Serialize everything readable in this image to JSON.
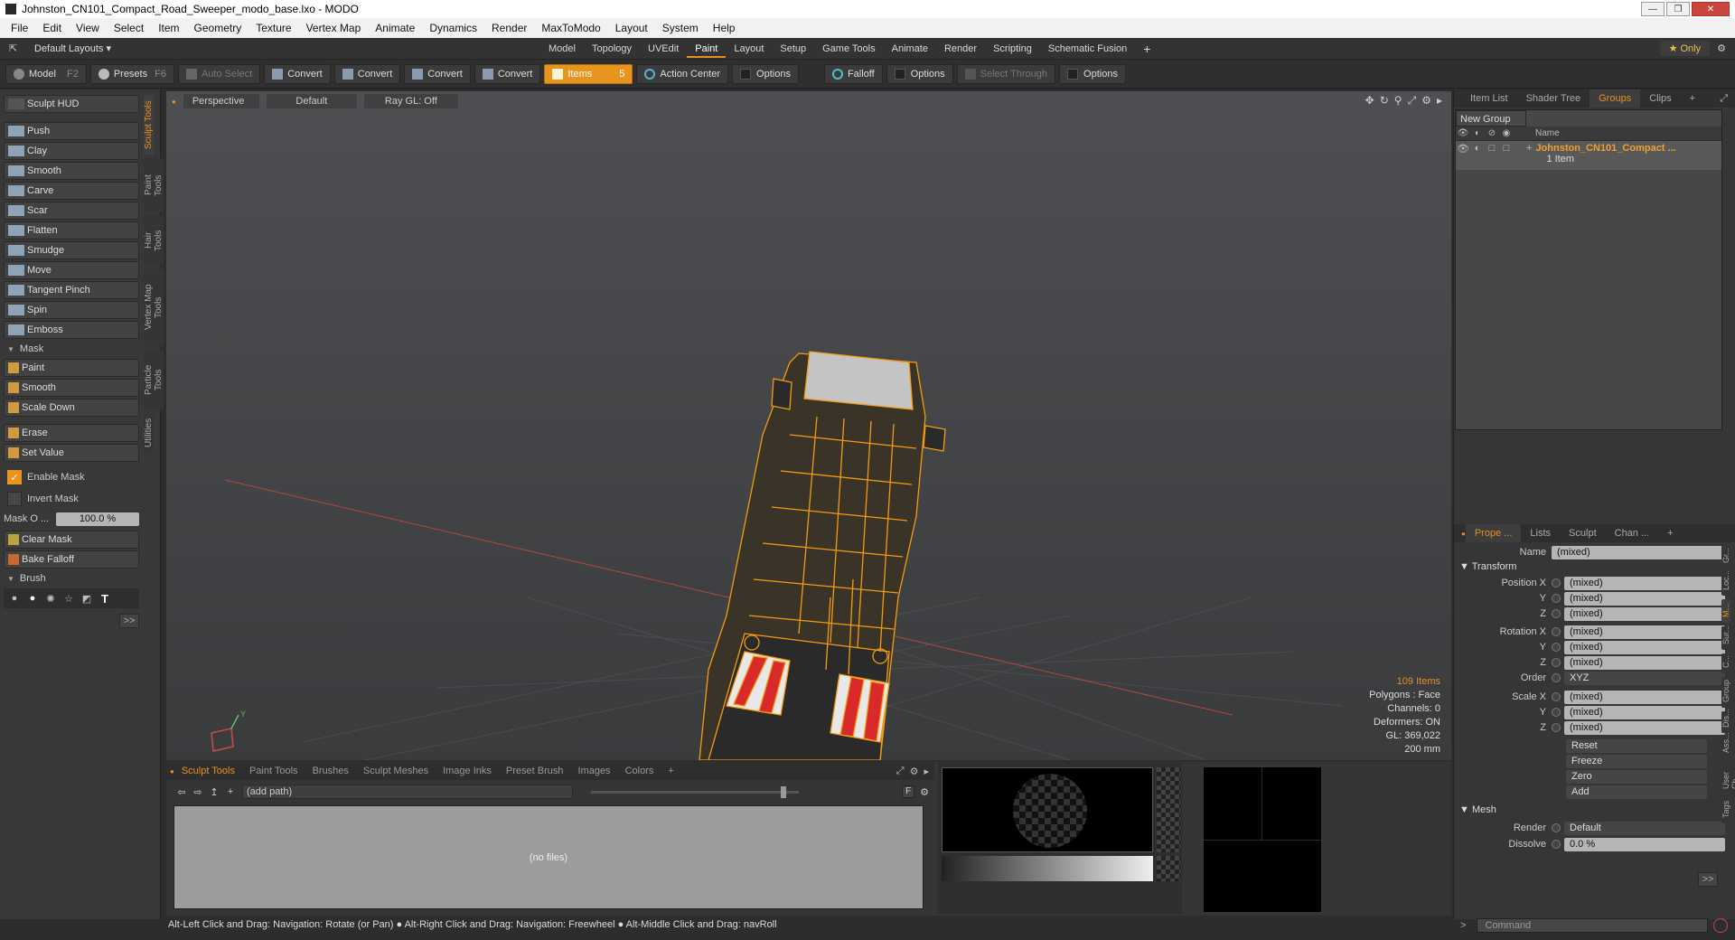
{
  "window": {
    "title": "Johnston_CN101_Compact_Road_Sweeper_modo_base.lxo - MODO"
  },
  "menu": [
    "File",
    "Edit",
    "View",
    "Select",
    "Item",
    "Geometry",
    "Texture",
    "Vertex Map",
    "Animate",
    "Dynamics",
    "Render",
    "MaxToModo",
    "Layout",
    "System",
    "Help"
  ],
  "layoutbar": {
    "layouts_label": "Default Layouts ▾",
    "tabs": [
      "Model",
      "Topology",
      "UVEdit",
      "Paint",
      "Layout",
      "Setup",
      "Game Tools",
      "Animate",
      "Render",
      "Scripting",
      "Schematic Fusion"
    ],
    "active_tab": "Paint",
    "add": "+",
    "only_label": "★ Only"
  },
  "toolbar": {
    "model": "Model",
    "model_key": "F2",
    "presets": "Presets",
    "presets_key": "F6",
    "auto_select": "Auto Select",
    "convert1": "Convert",
    "convert2": "Convert",
    "convert3": "Convert",
    "convert4": "Convert",
    "items": "Items",
    "items_key": "5",
    "action_center": "Action Center",
    "options1": "Options",
    "falloff": "Falloff",
    "options2": "Options",
    "select_through": "Select Through",
    "options3": "Options"
  },
  "left": {
    "hud": "Sculpt HUD",
    "tools": [
      "Push",
      "Clay",
      "Smooth",
      "Carve",
      "Scar",
      "Flatten",
      "Smudge",
      "Move",
      "Tangent Pinch",
      "Spin",
      "Emboss"
    ],
    "mask_header": "Mask",
    "mask_tools": [
      "Paint",
      "Smooth",
      "Scale Down"
    ],
    "erase": "Erase",
    "set_value": "Set Value",
    "enable_mask": "Enable Mask",
    "invert_mask": "Invert Mask",
    "mask_opacity_label": "Mask O ...",
    "mask_opacity_value": "100.0 %",
    "clear_mask": "Clear Mask",
    "bake_falloff": "Bake Falloff",
    "brush_header": "Brush",
    "expand": ">>",
    "vtabs": [
      "Sculpt Tools",
      "Paint Tools",
      "Hair Tools",
      "Vertex Map Tools",
      "Particle Tools",
      "Utilities"
    ]
  },
  "viewport": {
    "view": "Perspective",
    "shading": "Default",
    "raygl": "Ray GL: Off",
    "info": {
      "items": "109 Items",
      "polygons": "Polygons : Face",
      "channels": "Channels: 0",
      "deformers": "Deformers: ON",
      "gl": "GL: 369,022",
      "scale": "200 mm"
    }
  },
  "bottom": {
    "tabs": [
      "Sculpt Tools",
      "Paint Tools",
      "Brushes",
      "Sculpt Meshes",
      "Image Inks",
      "Preset Brush",
      "Images",
      "Colors"
    ],
    "add": "+",
    "path": "(add path)",
    "no_files": "(no files)",
    "f_label": "F"
  },
  "right": {
    "top_tabs": [
      "Item List",
      "Shader Tree",
      "Groups",
      "Clips"
    ],
    "active_top": "Groups",
    "new_group": "New Group",
    "name_col": "Name",
    "group_name": "Johnston_CN101_Compact ...",
    "group_count": "1 Item",
    "prop_tabs": [
      "Prope ...",
      "Lists",
      "Sculpt",
      "Chan ..."
    ],
    "name_label": "Name",
    "name_value": "(mixed)",
    "transform_header": "Transform",
    "position_x": "Position X",
    "rotation_x": "Rotation X",
    "scale_x": "Scale X",
    "y": "Y",
    "z": "Z",
    "mixed": "(mixed)",
    "order_label": "Order",
    "order_value": "XYZ",
    "reset": "Reset",
    "freeze": "Freeze",
    "zero": "Zero",
    "add": "Add",
    "mesh_header": "Mesh",
    "render_label": "Render",
    "render_value": "Default",
    "dissolve_label": "Dissolve",
    "dissolve_value": "0.0 %",
    "expand": ">>",
    "side_tabs": [
      "Gr...",
      "Loc...",
      "M...",
      "Sur...",
      "C...",
      "Group",
      "Dis...",
      "Ass...",
      "User Ch...",
      "Tags"
    ]
  },
  "status": "Alt-Left Click and Drag: Navigation: Rotate (or Pan) ● Alt-Right Click and Drag: Navigation: Freewheel ● Alt-Middle Click and Drag: navRoll",
  "command_placeholder": "Command",
  "colors": {
    "accent": "#e98f22",
    "wire": "#f39c12"
  }
}
